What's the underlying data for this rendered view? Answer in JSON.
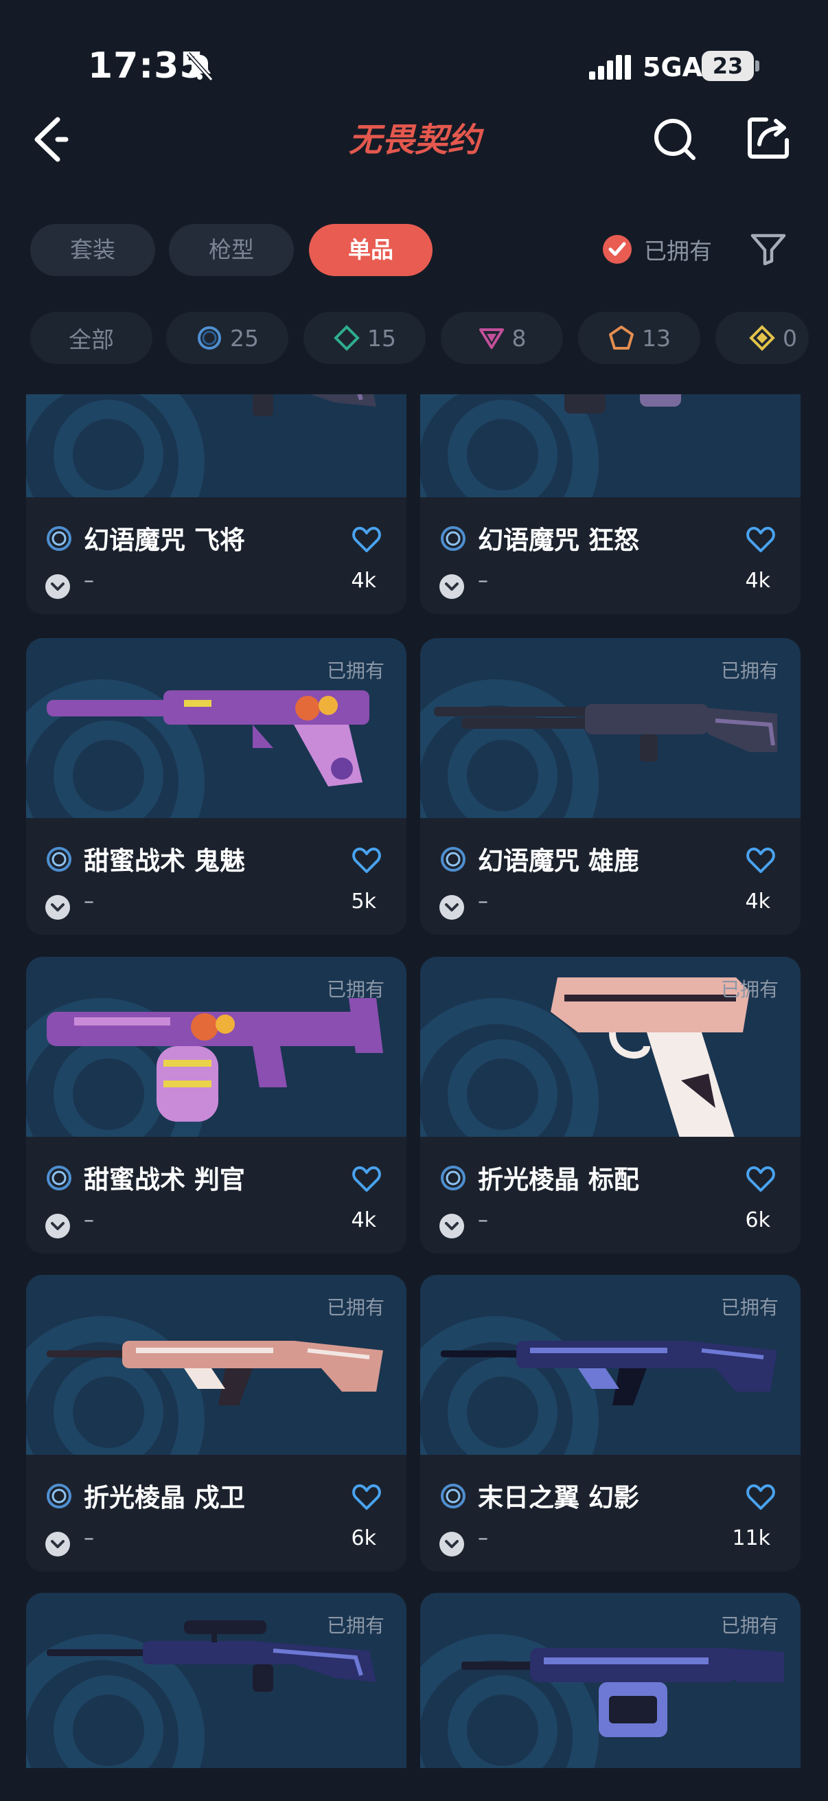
{
  "status_bar": {
    "time": "17:35",
    "network": "5GA",
    "battery": "23"
  },
  "header": {
    "title": "无畏契约"
  },
  "tabs": [
    {
      "label": "套装",
      "active": false
    },
    {
      "label": "枪型",
      "active": false
    },
    {
      "label": "单品",
      "active": true
    }
  ],
  "owned_filter": {
    "label": "已拥有",
    "checked": true
  },
  "tier_chips": [
    {
      "label": "全部"
    },
    {
      "count": "25",
      "tier": "select",
      "color": "#4f8fd0"
    },
    {
      "count": "15",
      "tier": "deluxe",
      "color": "#2fae8e"
    },
    {
      "count": "8",
      "tier": "premium",
      "color": "#c34f9a"
    },
    {
      "count": "13",
      "tier": "exclusive",
      "color": "#e48e50"
    },
    {
      "count": "0",
      "tier": "ultra",
      "color": "#e3c34a"
    }
  ],
  "cards": [
    {
      "name": "幻语魔咒 飞将",
      "owned": "",
      "likes": "4k",
      "sub": "–",
      "weapon": "sniper",
      "palette": [
        "#3c3e55",
        "#7a6b9e",
        "#2a2c3a"
      ]
    },
    {
      "name": "幻语魔咒 狂怒",
      "owned": "",
      "likes": "4k",
      "sub": "–",
      "weapon": "smg",
      "palette": [
        "#3c3e55",
        "#7a6b9e",
        "#2a2c3a"
      ]
    },
    {
      "name": "甜蜜战术 鬼魅",
      "owned": "已拥有",
      "likes": "5k",
      "sub": "–",
      "weapon": "pistol-long",
      "palette": [
        "#8a4fb0",
        "#c98ad8",
        "#e9d34a"
      ]
    },
    {
      "name": "幻语魔咒 雄鹿",
      "owned": "已拥有",
      "likes": "4k",
      "sub": "–",
      "weapon": "shotgun",
      "palette": [
        "#3c3e55",
        "#7a6b9e",
        "#2a2c3a"
      ]
    },
    {
      "name": "甜蜜战术 判官",
      "owned": "已拥有",
      "likes": "4k",
      "sub": "–",
      "weapon": "drum-shotgun",
      "palette": [
        "#8a4fb0",
        "#c98ad8",
        "#e9d34a"
      ]
    },
    {
      "name": "折光棱晶 标配",
      "owned": "已拥有",
      "likes": "6k",
      "sub": "–",
      "weapon": "pistol",
      "palette": [
        "#e7b2a8",
        "#f4ece8",
        "#2c2230"
      ]
    },
    {
      "name": "折光棱晶 戍卫",
      "owned": "已拥有",
      "likes": "6k",
      "sub": "–",
      "weapon": "rifle",
      "palette": [
        "#d79a90",
        "#f2e6e2",
        "#2e2630"
      ]
    },
    {
      "name": "末日之翼 幻影",
      "owned": "已拥有",
      "likes": "11k",
      "sub": "–",
      "weapon": "rifle",
      "palette": [
        "#2b2f6a",
        "#6d79d4",
        "#111326"
      ]
    },
    {
      "name": "",
      "owned": "已拥有",
      "likes": "",
      "sub": "",
      "weapon": "sniper",
      "palette": [
        "#2b2f6a",
        "#6d79d4",
        "#1b1d30"
      ]
    },
    {
      "name": "",
      "owned": "已拥有",
      "likes": "",
      "sub": "",
      "weapon": "lmg",
      "palette": [
        "#2b2f6a",
        "#6d79d4",
        "#1b1d30"
      ]
    }
  ]
}
